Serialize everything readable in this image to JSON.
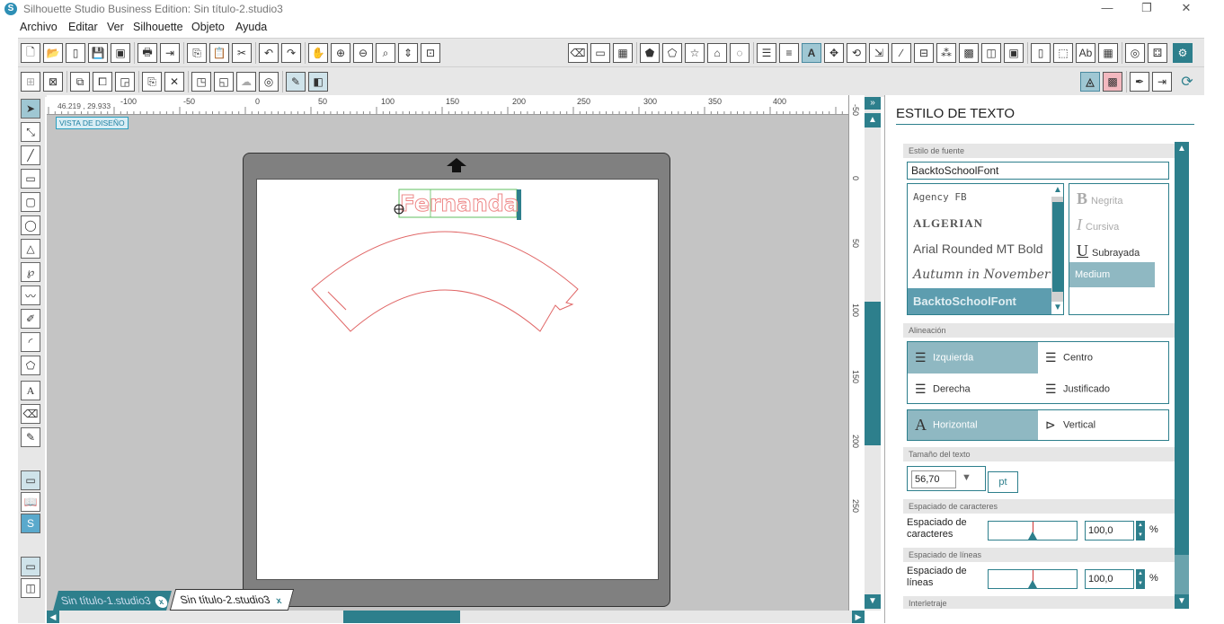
{
  "window": {
    "title": "Silhouette Studio Business Edition: Sin título-2.studio3",
    "logo": "S",
    "minimize": "—",
    "maximize": "❐",
    "close": "✕"
  },
  "menu": [
    "Archivo",
    "Editar",
    "Ver",
    "Silhouette",
    "Objeto",
    "Ayuda"
  ],
  "canvas": {
    "view_label": "VISTA DE DISEÑO",
    "coordinates": "46.219 , 29.933",
    "ruler_h": [
      "-100",
      "-50",
      "0",
      "50",
      "100",
      "150",
      "200",
      "250",
      "300",
      "350",
      "400"
    ],
    "ruler_v": [
      "-50",
      "0",
      "50",
      "100",
      "150",
      "200",
      "250"
    ],
    "text_object": "Fernanda"
  },
  "tabs": [
    {
      "label": "Sin título-1.studio3",
      "close": "x"
    },
    {
      "label": "Sin título-2.studio3",
      "close": "x"
    }
  ],
  "panel": {
    "title": "ESTILO DE TEXTO",
    "font_section": "Estilo de fuente",
    "font_value": "BacktoSchoolFont",
    "fonts": [
      "Agency FB",
      "ALGERIAN",
      "Arial Rounded MT Bold",
      "Autumn in November",
      "BacktoSchoolFont"
    ],
    "selected_font": "BacktoSchoolFont",
    "styles": {
      "bold": "Negrita",
      "italic": "Cursiva",
      "underline": "Subrayada",
      "medium": "Medium"
    },
    "align_section": "Alineación",
    "align": {
      "left": "Izquierda",
      "center": "Centro",
      "right": "Derecha",
      "justify": "Justificado"
    },
    "orientation": {
      "horizontal": "Horizontal",
      "vertical": "Vertical"
    },
    "size_section": "Tamaño del texto",
    "size_value": "56,70",
    "size_unit": "pt",
    "char_spacing_section": "Espaciado de caracteres",
    "char_spacing_label": "Espaciado de caracteres",
    "char_spacing_value": "100,0",
    "line_spacing_section": "Espaciado de líneas",
    "line_spacing_label": "Espaciado de líneas",
    "line_spacing_value": "100,0",
    "percent": "%",
    "kerning_section": "Interletraje"
  },
  "colors": {
    "accent": "#2d7f8c",
    "selection": "#8fb8c2",
    "cut_line": "#e06666"
  }
}
